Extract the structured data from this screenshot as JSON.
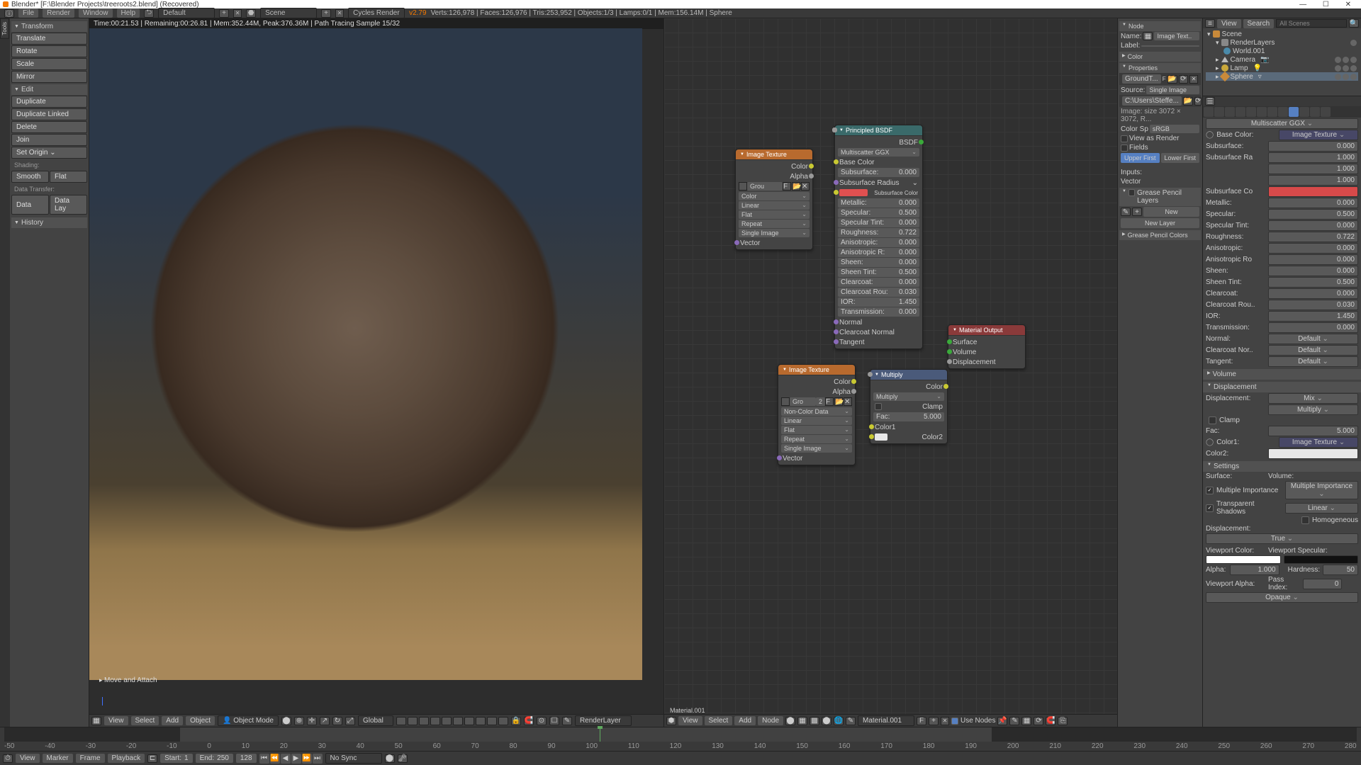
{
  "window": {
    "title": "Blender* [F:\\Blender Projects\\treeroots2.blend] (Recovered)"
  },
  "menus": {
    "file": "File",
    "render": "Render",
    "window": "Window",
    "help": "Help"
  },
  "infobar": {
    "layout": "Default",
    "scene": "Scene",
    "engine": "Cycles Render",
    "version": "v2.79",
    "stats": "Verts:126,978 | Faces:126,976 | Tris:253,952 | Objects:1/3 | Lamps:0/1 | Mem:156.14M | Sphere"
  },
  "toolshelf": {
    "transform": "Transform",
    "translate": "Translate",
    "rotate": "Rotate",
    "scale": "Scale",
    "mirror": "Mirror",
    "edit": "Edit",
    "duplicate": "Duplicate",
    "dup_linked": "Duplicate Linked",
    "delete": "Delete",
    "join": "Join",
    "set_origin": "Set Origin",
    "shading": "Shading:",
    "smooth": "Smooth",
    "flat": "Flat",
    "data_transfer": "Data Transfer:",
    "data": "Data",
    "data_lay": "Data Lay",
    "history": "History"
  },
  "status_msg": "Move and Attach",
  "render_status": "Time:00:21.53 | Remaining:00:26.81 | Mem:352.44M, Peak:376.36M | Path Tracing Sample 15/32",
  "view_hdr": {
    "view": "View",
    "select": "Select",
    "add": "Add",
    "object": "Object",
    "mode": "Object Mode",
    "global": "Global",
    "layer": "RenderLayer"
  },
  "nodes": {
    "img_tex": {
      "title": "Image Texture",
      "out_color": "Color",
      "out_alpha": "Alpha",
      "file_short": "Grou",
      "opt_color": "Color",
      "opt_linear": "Linear",
      "opt_flat": "Flat",
      "opt_repeat": "Repeat",
      "opt_single": "Single Image",
      "in_vector": "Vector"
    },
    "img_tex2": {
      "title": "Image Texture",
      "file_short": "Gro",
      "file_n": "2",
      "opt_ncd": "Non-Color Data",
      "opt_linear": "Linear",
      "opt_flat": "Flat",
      "opt_repeat": "Repeat",
      "opt_single": "Single Image",
      "in_vector": "Vector"
    },
    "principled": {
      "title": "Principled BSDF",
      "out": "BSDF",
      "dist": "Multiscatter GGX",
      "base": "Base Color",
      "sub": "Subsurface:",
      "sub_v": "0.000",
      "sub_r": "Subsurface Radius",
      "sub_c": "Subsurface Color",
      "met": "Metallic:",
      "met_v": "0.000",
      "spec": "Specular:",
      "spec_v": "0.500",
      "spect": "Specular Tint:",
      "spect_v": "0.000",
      "rough": "Roughness:",
      "rough_v": "0.722",
      "aniso": "Anisotropic:",
      "aniso_v": "0.000",
      "anisor": "Anisotropic R:",
      "anisor_v": "0.000",
      "sheen": "Sheen:",
      "sheen_v": "0.000",
      "sheent": "Sheen Tint:",
      "sheent_v": "0.500",
      "clear": "Clearcoat:",
      "clear_v": "0.000",
      "clearr": "Clearcoat Rou:",
      "clearr_v": "0.030",
      "ior": "IOR:",
      "ior_v": "1.450",
      "trans": "Transmission:",
      "trans_v": "0.000",
      "normal": "Normal",
      "cnormal": "Clearcoat Normal",
      "tangent": "Tangent"
    },
    "mix": {
      "title": "Multiply",
      "out": "Color",
      "mode": "Multiply",
      "clamp": "Clamp",
      "fac": "Fac:",
      "fac_v": "5.000",
      "c1": "Color1",
      "c2": "Color2"
    },
    "mat_out": {
      "title": "Material Output",
      "surf": "Surface",
      "vol": "Volume",
      "disp": "Displacement"
    },
    "breadcrumb": "Material.001"
  },
  "node_hdr": {
    "view": "View",
    "select": "Select",
    "add": "Add",
    "node": "Node",
    "mat": "Material.001",
    "use": "Use Nodes"
  },
  "npanel": {
    "node_h": "Node",
    "name_l": "Name:",
    "name_v": "Image Text..",
    "label_l": "Label:",
    "color_h": "Color",
    "props_h": "Properties",
    "color_sp": "Color Sp",
    "srgb": "sRGB",
    "view_render": "View as Render",
    "fields": "Fields",
    "upper": "Upper First",
    "lower": "Lower First",
    "inputs": "Inputs:",
    "vector": "Vector",
    "gp_layers": "Grease Pencil Layers",
    "new": "New",
    "new_layer": "New Layer",
    "gp_colors": "Grease Pencil Colors",
    "bc_ground": "GroundT...",
    "src": "Source:",
    "single": "Single Image",
    "bc_path": "C:\\Users\\Steffe...",
    "img_info": "Image: size 3072 × 3072, R..."
  },
  "outliner": {
    "view": "View",
    "search": "Search",
    "scenes": "All Scenes",
    "scene": "Scene",
    "render_layers": "RenderLayers",
    "world": "World.001",
    "camera": "Camera",
    "lamp": "Lamp",
    "sphere": "Sphere"
  },
  "props": {
    "dist": "Multiscatter GGX",
    "base_l": "Base Color:",
    "base_v": "Image Texture",
    "sub_l": "Subsurface:",
    "sub_v": "0.000",
    "subr_l": "Subsurface Ra",
    "subr_v1": "1.000",
    "subr_v2": "1.000",
    "subr_v3": "1.000",
    "subc_l": "Subsurface Co",
    "met_l": "Metallic:",
    "met_v": "0.000",
    "spec_l": "Specular:",
    "spec_v": "0.500",
    "spect_l": "Specular Tint:",
    "spect_v": "0.000",
    "rough_l": "Roughness:",
    "rough_v": "0.722",
    "aniso_l": "Anisotropic:",
    "aniso_v": "0.000",
    "anisor_l": "Anisotropic Ro",
    "anisor_v": "0.000",
    "sheen_l": "Sheen:",
    "sheen_v": "0.000",
    "sheent_l": "Sheen Tint:",
    "sheent_v": "0.500",
    "clear_l": "Clearcoat:",
    "clear_v": "0.000",
    "clearr_l": "Clearcoat Rou..",
    "clearr_v": "0.030",
    "ior_l": "IOR:",
    "ior_v": "1.450",
    "trans_l": "Transmission:",
    "trans_v": "0.000",
    "normal_l": "Normal:",
    "normal_v": "Default",
    "cnorm_l": "Clearcoat Nor..",
    "cnorm_v": "Default",
    "tangent_l": "Tangent:",
    "tangent_v": "Default",
    "volume_h": "Volume",
    "disp_h": "Displacement",
    "disp_l": "Displacement:",
    "disp_v": "Mix",
    "mode": "Multiply",
    "clamp": "Clamp",
    "fac_l": "Fac:",
    "fac_v": "5.000",
    "c1_l": "Color1:",
    "c1_v": "Image Texture",
    "c2_l": "Color2:",
    "settings_h": "Settings",
    "surf_l": "Surface:",
    "vol_l": "Volume:",
    "multi": "Multiple Importance",
    "multi2": "Multiple Importance",
    "transp": "Transparent Shadows",
    "linear": "Linear",
    "homo": "Homogeneous",
    "disp2_l": "Displacement:",
    "true": "True",
    "vcolor": "Viewport Color:",
    "vspec": "Viewport Specular:",
    "alpha": "Alpha:",
    "alpha_v": "1.000",
    "hard": "Hardness:",
    "hard_v": "50",
    "valpha": "Viewport Alpha:",
    "pass": "Pass Index:",
    "pass_v": "0",
    "opaque": "Opaque"
  },
  "timeline": {
    "ticks": [
      "-50",
      "-40",
      "-30",
      "-20",
      "-10",
      "0",
      "10",
      "20",
      "30",
      "40",
      "50",
      "60",
      "70",
      "80",
      "90",
      "100",
      "110",
      "120",
      "130",
      "140",
      "150",
      "160",
      "170",
      "180",
      "190",
      "200",
      "210",
      "220",
      "230",
      "240",
      "250",
      "260",
      "270",
      "280"
    ],
    "start": "1",
    "end": "250",
    "current": "128"
  },
  "bottom": {
    "view": "View",
    "marker": "Marker",
    "frame": "Frame",
    "playback": "Playback",
    "start_l": "Start:",
    "end_l": "End:",
    "nosync": "No Sync"
  }
}
